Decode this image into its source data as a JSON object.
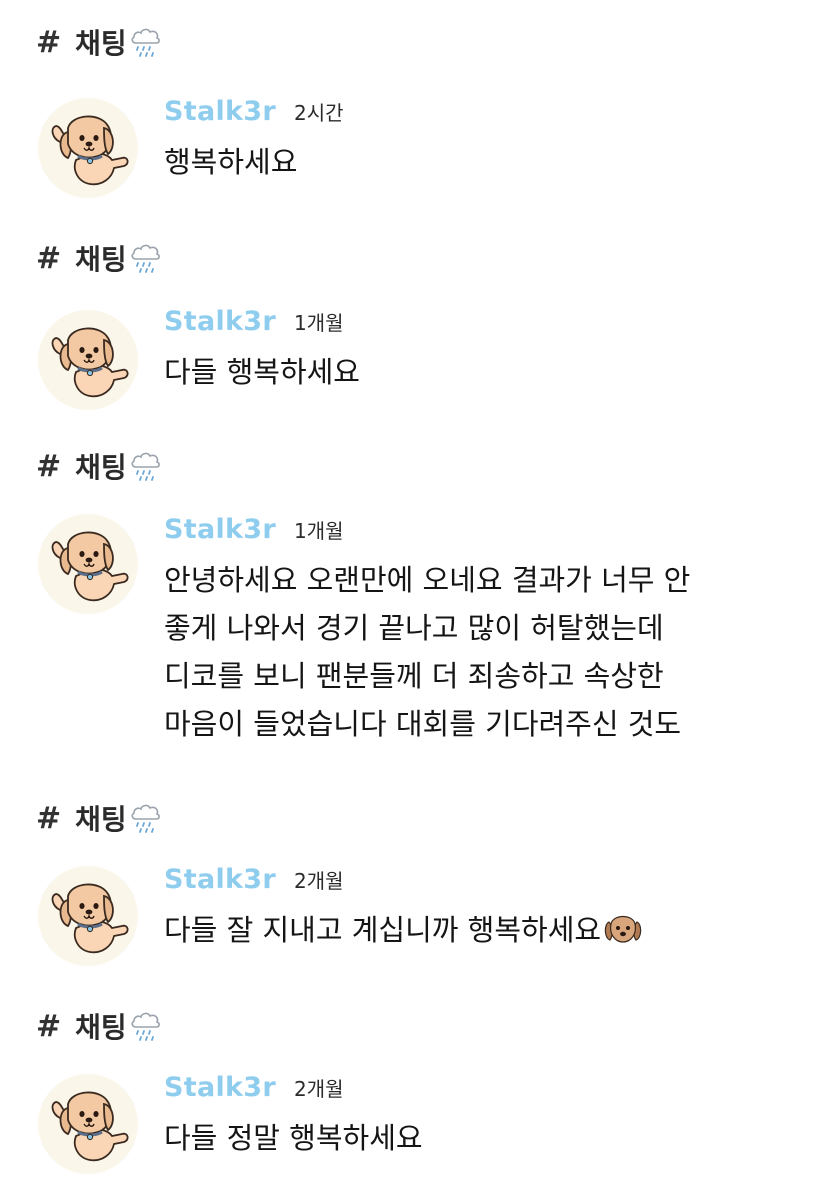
{
  "colors": {
    "author": "#8fcdee",
    "text": "#151515",
    "background": "#ffffff"
  },
  "posts": [
    {
      "channel": {
        "hash": "#",
        "name": "채팅",
        "icon": "cloud-rain-icon"
      },
      "author": "Stalk3r",
      "time": "2시간",
      "text": "행복하세요"
    },
    {
      "channel": {
        "hash": "#",
        "name": "채팅",
        "icon": "cloud-rain-icon"
      },
      "author": "Stalk3r",
      "time": "1개월",
      "text": "다들 행복하세요"
    },
    {
      "channel": {
        "hash": "#",
        "name": "채팅",
        "icon": "cloud-rain-icon"
      },
      "author": "Stalk3r",
      "time": "1개월",
      "text": "안녕하세요 오랜만에 오네요 결과가 너무 안\n좋게 나와서 경기 끝나고 많이 허탈했는데\n디코를 보니 팬분들께 더 죄송하고 속상한\n마음이 들었습니다 대회를 기다려주신 것도"
    },
    {
      "channel": {
        "hash": "#",
        "name": "채팅",
        "icon": "cloud-rain-icon"
      },
      "author": "Stalk3r",
      "time": "2개월",
      "text": "다들 잘 지내고 계십니까 행복하세요",
      "trailing_emoji": "dog-face-emoji"
    },
    {
      "channel": {
        "hash": "#",
        "name": "채팅",
        "icon": "cloud-rain-icon"
      },
      "author": "Stalk3r",
      "time": "2개월",
      "text": "다들 정말 행복하세요"
    }
  ]
}
